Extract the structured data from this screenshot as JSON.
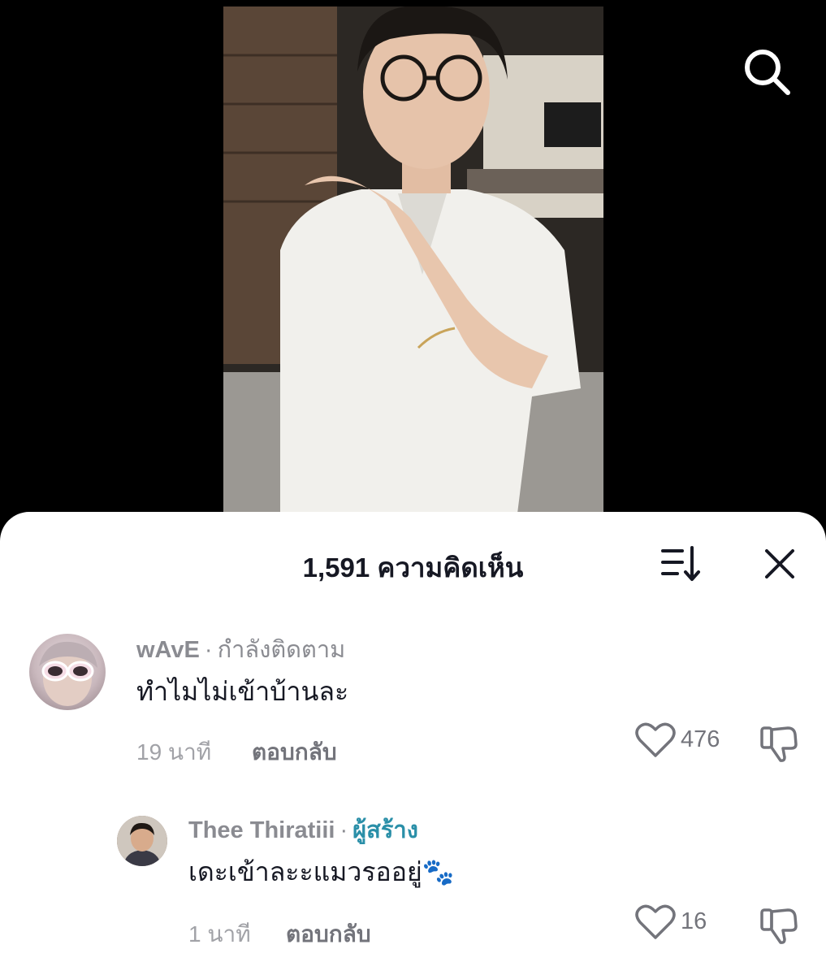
{
  "comments_panel": {
    "title": "1,591 ความคิดเห็น"
  },
  "comments": [
    {
      "username": "wAvE",
      "relation": "กำลังติดตาม",
      "text": "ทำไมไม่เข้าบ้านละ",
      "time": "19 นาที",
      "reply_label": "ตอบกลับ",
      "likes": "476"
    }
  ],
  "replies": [
    {
      "username": "Thee Thiratiii",
      "badge": "ผู้สร้าง",
      "text": "เดะเข้าละะแมวรออยู่",
      "emoji": "🐾",
      "time": "1 นาที",
      "reply_label": "ตอบกลับ",
      "likes": "16"
    }
  ],
  "icons": {
    "search": "search-icon",
    "sort": "sort-icon",
    "close": "close-icon",
    "like": "heart-icon",
    "dislike": "thumbs-down-icon"
  },
  "colors": {
    "creator_badge": "#2a8fa8",
    "text_primary": "#161823",
    "text_secondary": "#8a8b91"
  }
}
